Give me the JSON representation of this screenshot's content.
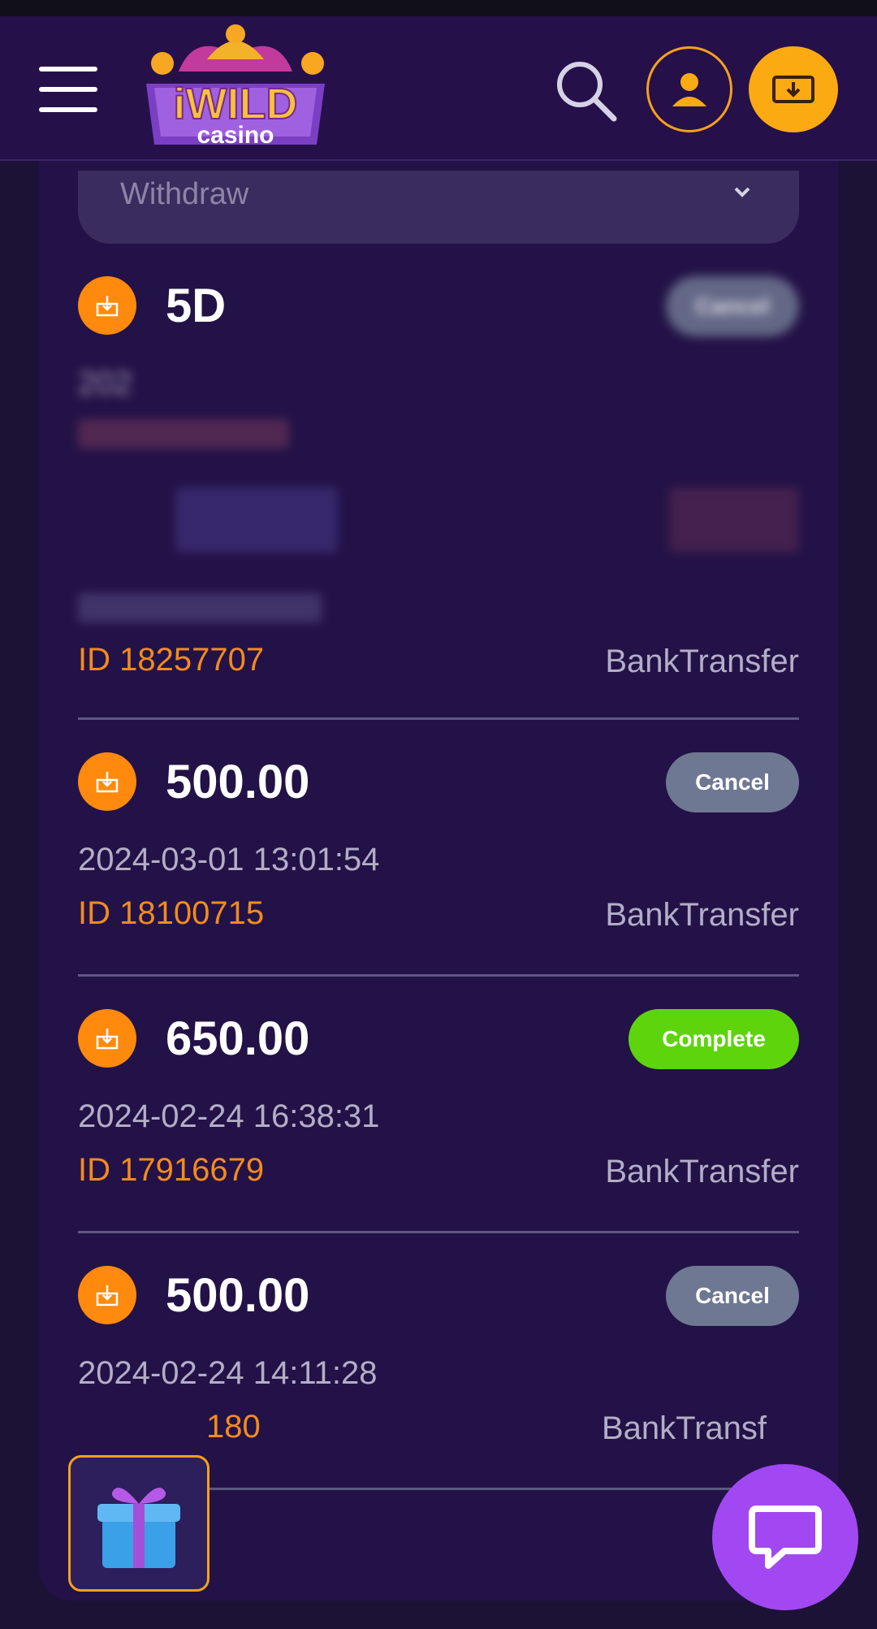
{
  "header": {
    "brand_name": "iWILD",
    "brand_sub": "casino",
    "icons": {
      "menu": "hamburger-menu-icon",
      "search": "search-icon",
      "profile": "user-icon",
      "deposit": "cash-deposit-icon"
    },
    "colors": {
      "accent": "#fbaa12",
      "header_bg": "#26104a"
    }
  },
  "filter": {
    "selected": "Withdraw"
  },
  "transactions": [
    {
      "amount": "5D",
      "status": "Cancel",
      "date": "202",
      "id": "ID 18257707",
      "method": "BankTransfer",
      "obscured": true
    },
    {
      "amount": "500.00",
      "status": "Cancel",
      "date": "2024-03-01 13:01:54",
      "id": "ID 18100715",
      "method": "BankTransfer"
    },
    {
      "amount": "650.00",
      "status": "Complete",
      "date": "2024-02-24 16:38:31",
      "id": "ID 17916679",
      "method": "BankTransfer"
    },
    {
      "amount": "500.00",
      "status": "Cancel",
      "date": "2024-02-24 14:11:28",
      "id": "180",
      "method": "BankTransf"
    }
  ],
  "floating": {
    "gift_icon": "gift-icon",
    "chat_icon": "chat-bubble-icon"
  },
  "status_colors": {
    "cancel": "#6f7892",
    "complete": "#5ed40d",
    "id_text": "#f38b1c"
  }
}
